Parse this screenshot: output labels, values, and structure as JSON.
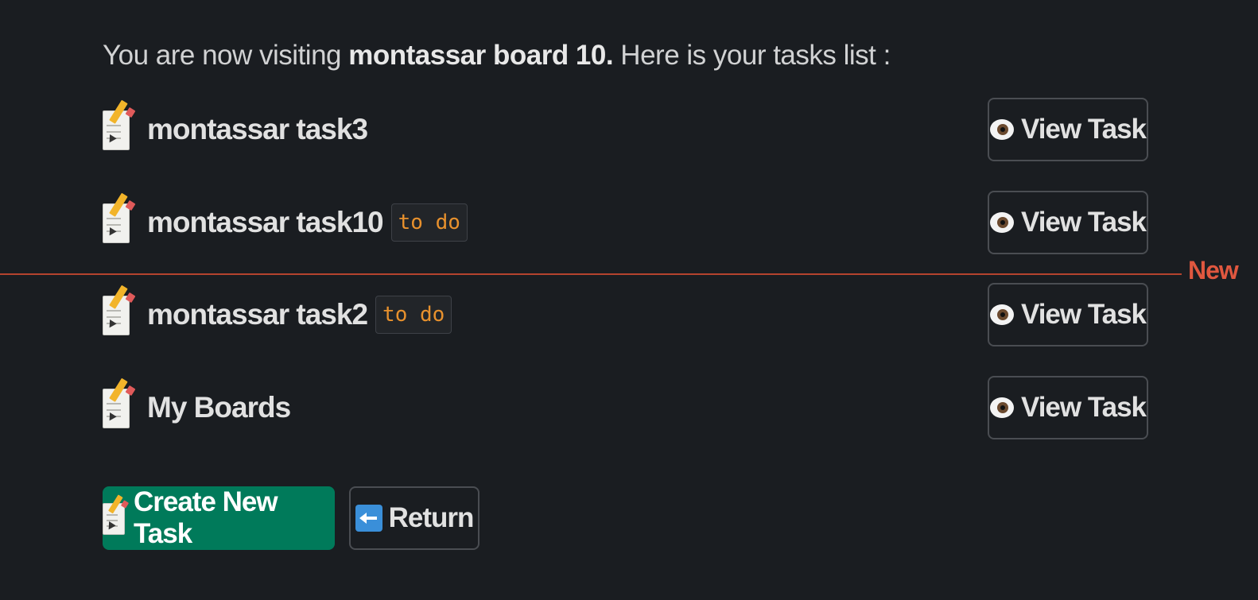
{
  "intro": {
    "prefix": "You are now visiting ",
    "board_name": "montassar board 10.",
    "suffix": " Here is your tasks list :"
  },
  "tasks": [
    {
      "icon": "memo-icon",
      "title": "montassar task3",
      "status": "",
      "view_label": "View Task"
    },
    {
      "icon": "memo-icon",
      "title": "montassar task10",
      "status": "to do",
      "view_label": "View Task"
    },
    {
      "icon": "memo-icon",
      "title": "montassar task2",
      "status": "to do",
      "view_label": "View Task"
    },
    {
      "icon": "memo-icon",
      "title": "My Boards",
      "status": "",
      "view_label": "View Task"
    }
  ],
  "divider": {
    "label": "New",
    "color": "#b4432e"
  },
  "actions": {
    "create_label": "Create New Task",
    "create_icon": "memo-icon",
    "return_label": "Return",
    "return_icon": "left-arrow-icon"
  },
  "colors": {
    "background": "#1a1d21",
    "create_button": "#007a5a",
    "status_text": "#e8912d",
    "new_label": "#e0573f"
  }
}
